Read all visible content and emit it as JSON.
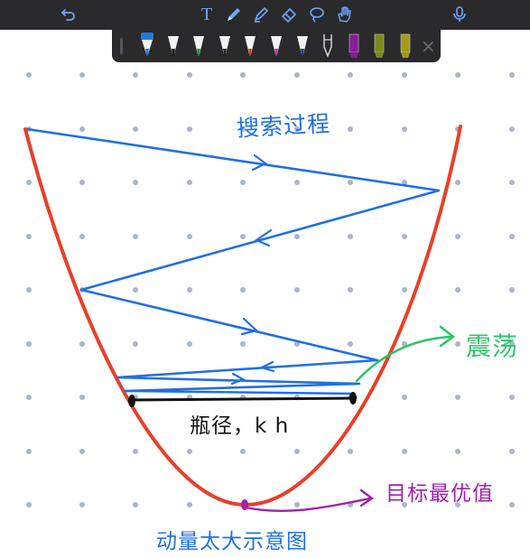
{
  "toolbar": {
    "text_tool_label": "T",
    "icons": [
      "undo-icon",
      "text-icon",
      "pen-icon",
      "highlighter-icon",
      "eraser-icon",
      "lasso-icon",
      "hand-icon",
      "microphone-icon"
    ]
  },
  "palette": {
    "pens": [
      {
        "name": "blue-pen",
        "color": "#1f7ae0",
        "selected": true
      },
      {
        "name": "black-pen",
        "color": "#111111"
      },
      {
        "name": "green-pen",
        "color": "#1a9d3a"
      },
      {
        "name": "dark-pen",
        "color": "#222222"
      },
      {
        "name": "red-pen",
        "color": "#e03a2a"
      },
      {
        "name": "magenta-pen",
        "color": "#d42aa8"
      },
      {
        "name": "navy-pen",
        "color": "#1b3d8f"
      },
      {
        "name": "white-pen",
        "color": "#ffffff"
      },
      {
        "name": "purple-marker",
        "color": "#8a1b9c"
      },
      {
        "name": "olive-marker",
        "color": "#7c8a1a"
      },
      {
        "name": "yellow-marker",
        "color": "#a49a1a"
      }
    ],
    "close_symbol": "×"
  },
  "annotations": {
    "search_process": "搜索过程",
    "oscillation": "震荡",
    "path_label": "瓶径，k h",
    "optimum": "目标最优值",
    "caption": "动量太大示意图"
  },
  "colors": {
    "curve": "#e8402a",
    "path": "#1f6fe6",
    "oscillation_arrow": "#2dc46a",
    "optimum_arrow": "#a31fb0",
    "dot_grid": "#aab4cc"
  }
}
